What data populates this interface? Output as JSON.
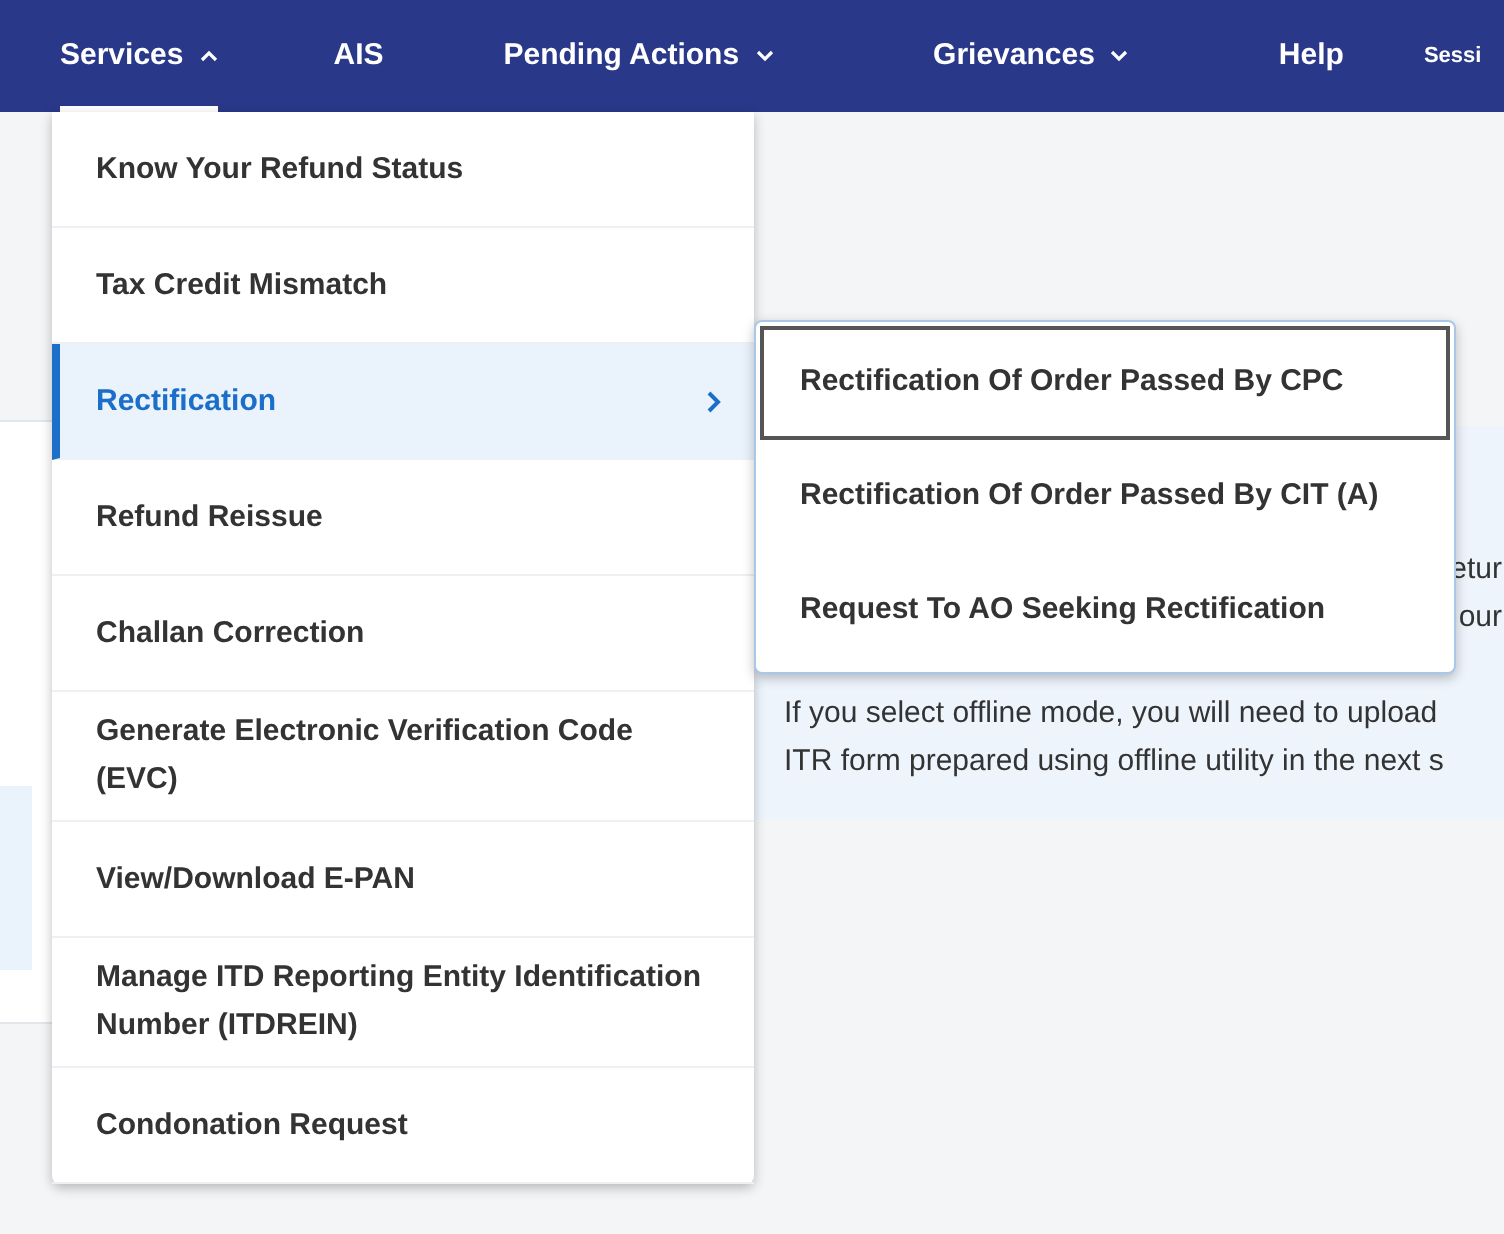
{
  "nav": [
    {
      "label": "Services",
      "kind": "dropdown",
      "expanded": true,
      "selected": true
    },
    {
      "label": "AIS",
      "kind": "link",
      "selected": false
    },
    {
      "label": "Pending Actions",
      "kind": "dropdown",
      "expanded": false,
      "selected": false
    },
    {
      "label": "Grievances",
      "kind": "dropdown",
      "expanded": false,
      "selected": false
    },
    {
      "label": "Help",
      "kind": "link",
      "selected": false
    },
    {
      "label": "Sessi",
      "kind": "small",
      "selected": false
    }
  ],
  "menu": [
    {
      "label": "Know Your Refund Status",
      "selected": false,
      "has_submenu": false
    },
    {
      "label": "Tax Credit Mismatch",
      "selected": false,
      "has_submenu": false
    },
    {
      "label": "Rectification",
      "selected": true,
      "has_submenu": true
    },
    {
      "label": "Refund Reissue",
      "selected": false,
      "has_submenu": false
    },
    {
      "label": "Challan Correction",
      "selected": false,
      "has_submenu": false
    },
    {
      "label": "Generate Electronic Verification Code (EVC)",
      "selected": false,
      "has_submenu": false
    },
    {
      "label": "View/Download E-PAN",
      "selected": false,
      "has_submenu": false
    },
    {
      "label": "Manage ITD Reporting Entity Identification Number (ITDREIN)",
      "selected": false,
      "has_submenu": false
    },
    {
      "label": "Condonation Request",
      "selected": false,
      "has_submenu": false
    }
  ],
  "submenu": [
    {
      "label": "Rectification Of Order Passed By CPC",
      "focused": true
    },
    {
      "label": "Rectification Of Order Passed By CIT (A)",
      "focused": false
    },
    {
      "label": "Request To AO Seeking Rectification",
      "focused": false
    }
  ],
  "info_panel": {
    "fragments": [
      "etur",
      "our"
    ],
    "lines": [
      "If you select offline mode, you will need to upload",
      "ITR form prepared using offline utility in the next s"
    ]
  }
}
